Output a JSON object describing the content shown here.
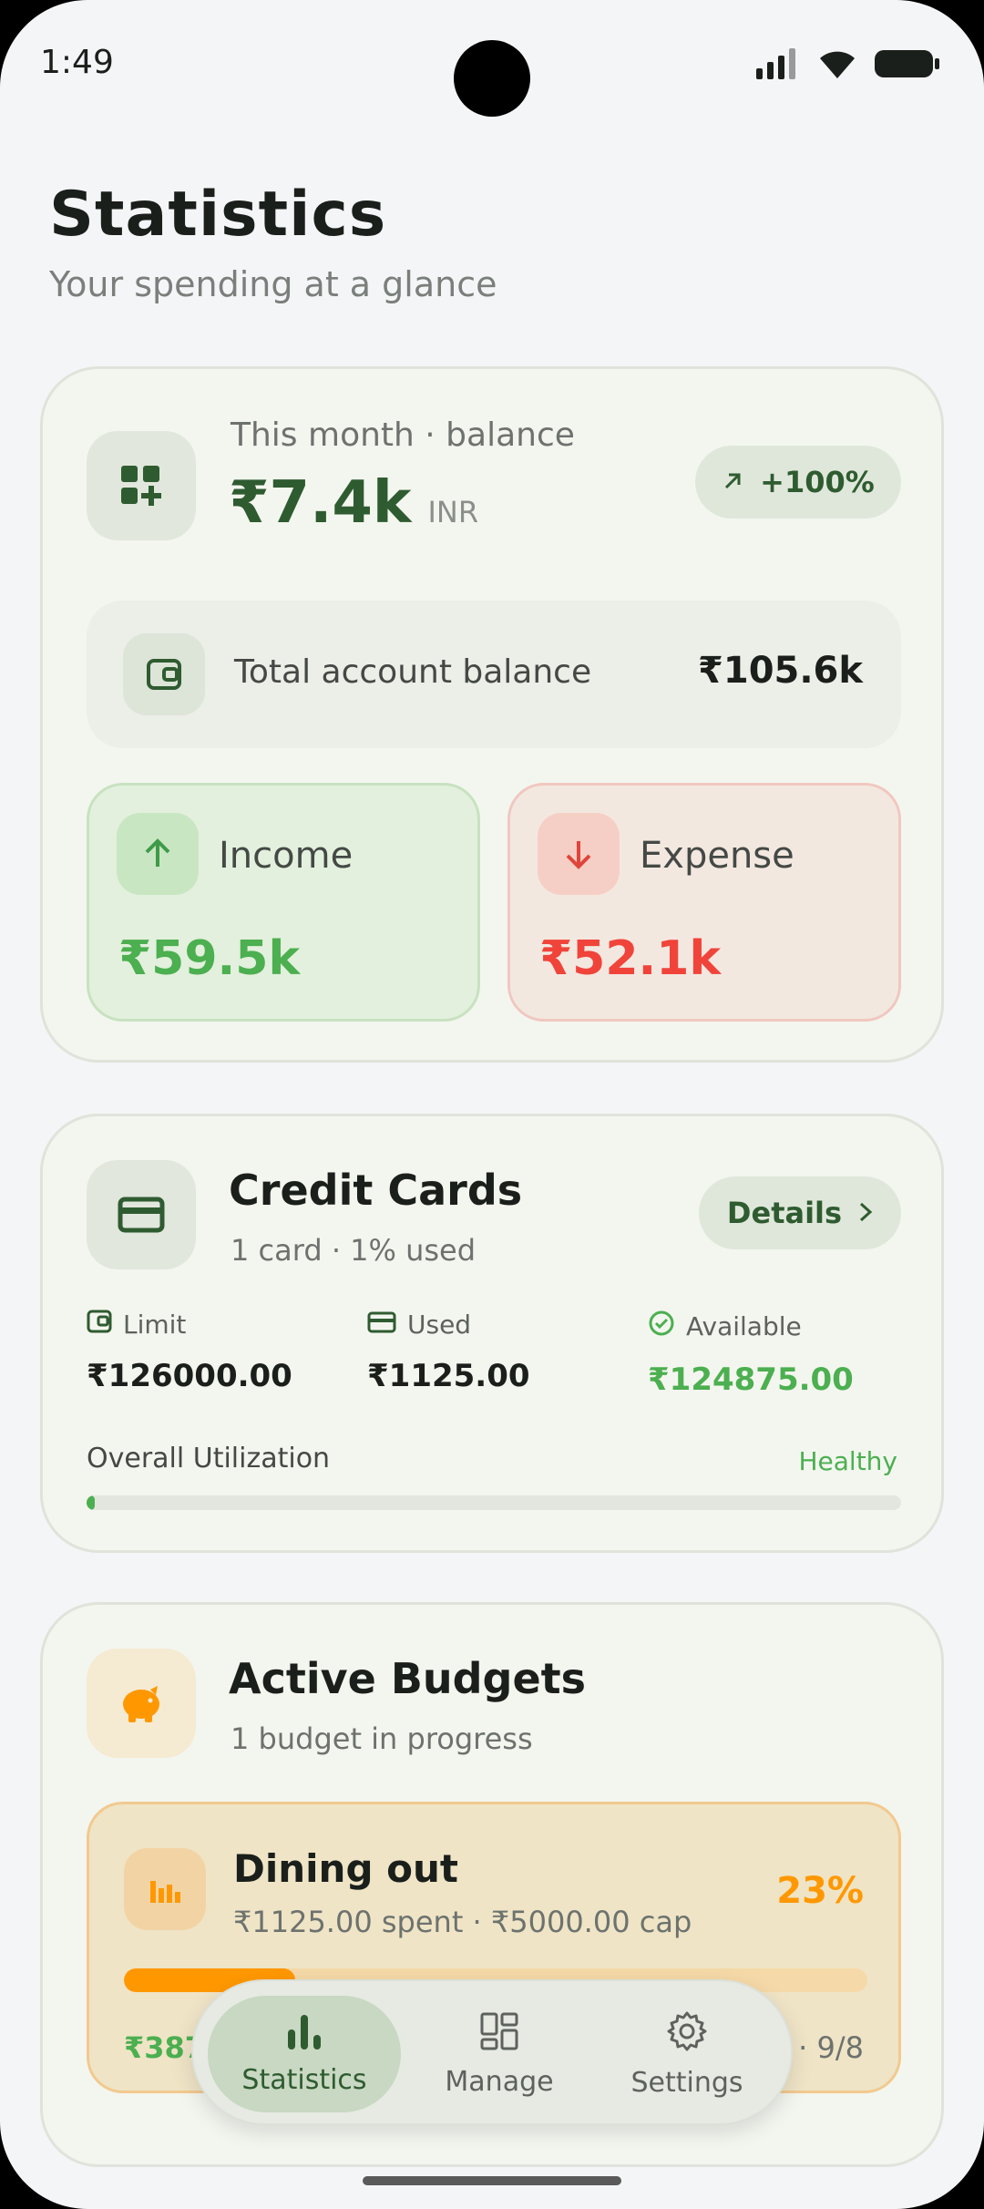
{
  "status_bar": {
    "time": "1:49"
  },
  "header": {
    "title": "Statistics",
    "subtitle": "Your spending at a glance"
  },
  "balance_card": {
    "label": "This month · balance",
    "amount": "₹7.4k",
    "currency": "INR",
    "change": "+100%",
    "total_label": "Total account balance",
    "total_value": "₹105.6k",
    "income": {
      "label": "Income",
      "value": "₹59.5k"
    },
    "expense": {
      "label": "Expense",
      "value": "₹52.1k"
    }
  },
  "credit_card": {
    "title": "Credit Cards",
    "subtitle": "1 card · 1% used",
    "details_label": "Details",
    "limit": {
      "label": "Limit",
      "value": "₹126000.00"
    },
    "used": {
      "label": "Used",
      "value": "₹1125.00"
    },
    "available": {
      "label": "Available",
      "value": "₹124875.00"
    },
    "utilization_label": "Overall Utilization",
    "utilization_status": "Healthy",
    "utilization_fraction": 0.01
  },
  "budgets": {
    "title": "Active Budgets",
    "subtitle": "1 budget in progress",
    "items": [
      {
        "name": "Dining out",
        "detail": "₹1125.00 spent · ₹5000.00 cap",
        "percent": "23%",
        "fraction": 0.23,
        "remaining_partial": "₹387",
        "days_partial": "· 9/8"
      }
    ]
  },
  "nav": {
    "items": [
      {
        "label": "Statistics",
        "icon": "bar-chart-icon"
      },
      {
        "label": "Manage",
        "icon": "dashboard-icon"
      },
      {
        "label": "Settings",
        "icon": "gear-icon"
      }
    ]
  },
  "colors": {
    "accent_green": "#2f5b30",
    "income_green": "#4caf50",
    "expense_red": "#f0443a",
    "budget_orange": "#ff9800"
  }
}
